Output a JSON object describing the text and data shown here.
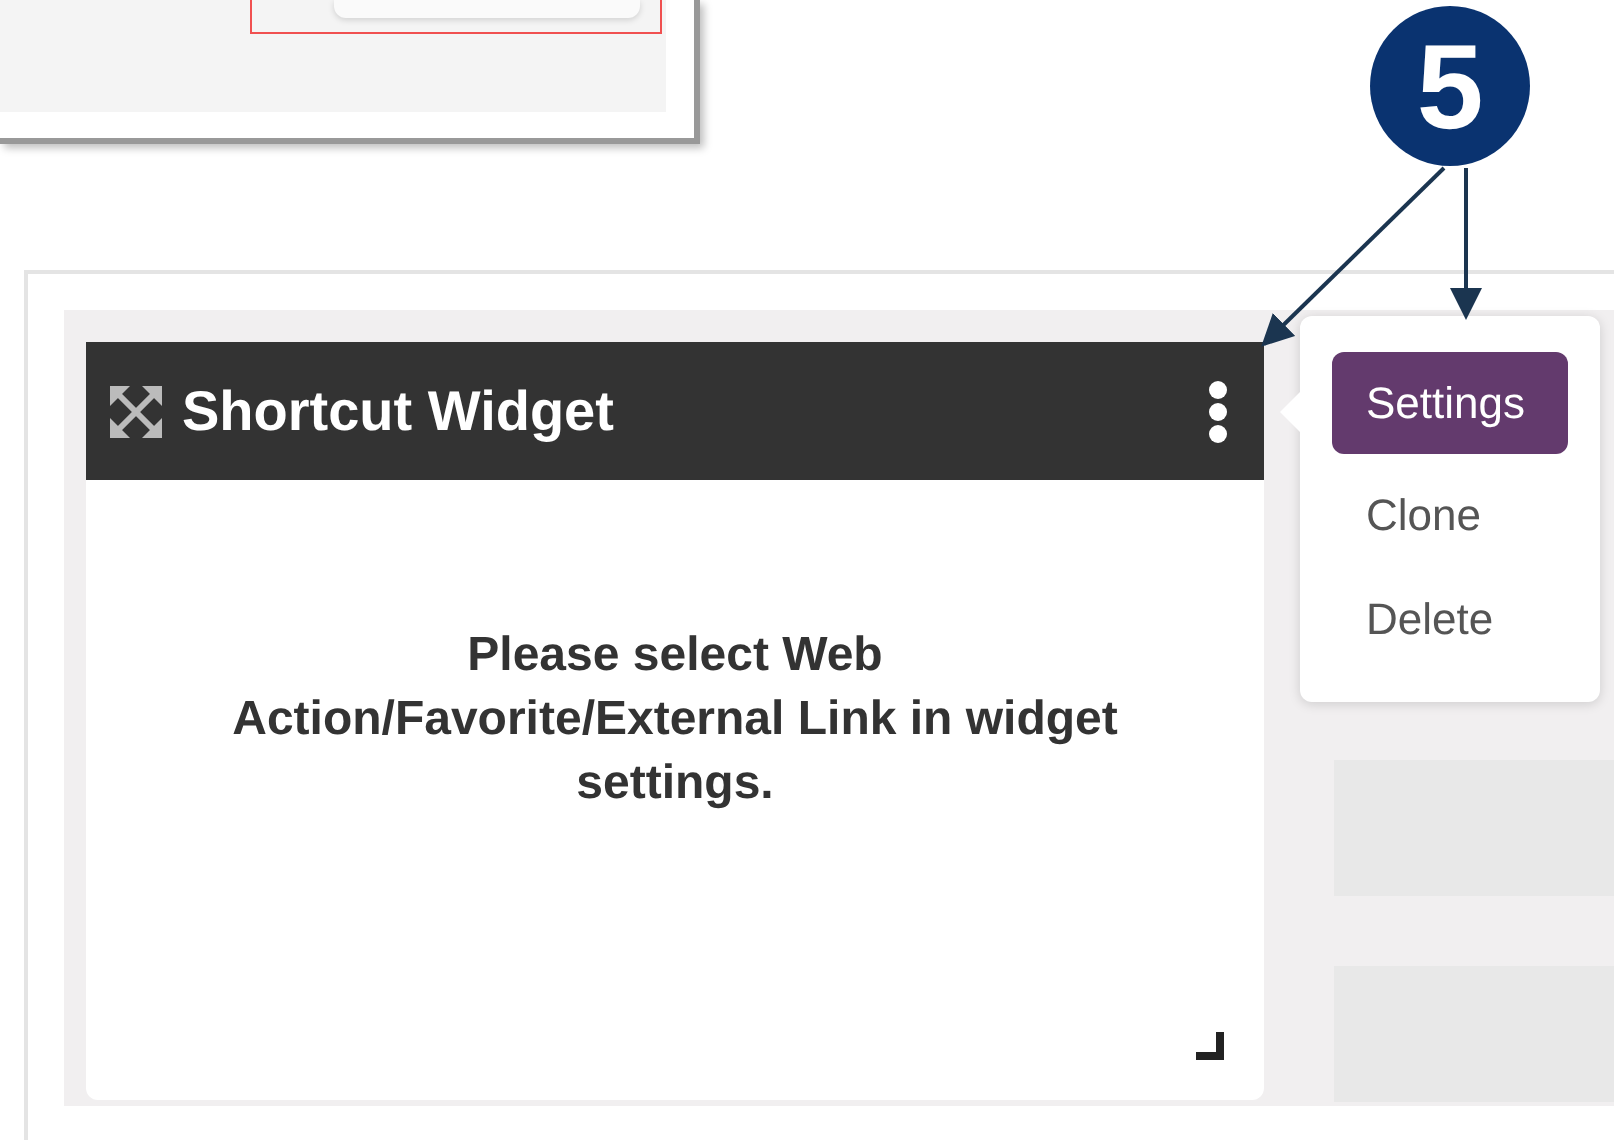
{
  "annotation": {
    "number": "5"
  },
  "widget": {
    "title": "Shortcut Widget",
    "message": "Please select Web Action/Favorite/External Link in widget settings."
  },
  "menu": {
    "items": [
      {
        "label": "Settings",
        "selected": true
      },
      {
        "label": "Clone",
        "selected": false
      },
      {
        "label": "Delete",
        "selected": false
      }
    ]
  }
}
